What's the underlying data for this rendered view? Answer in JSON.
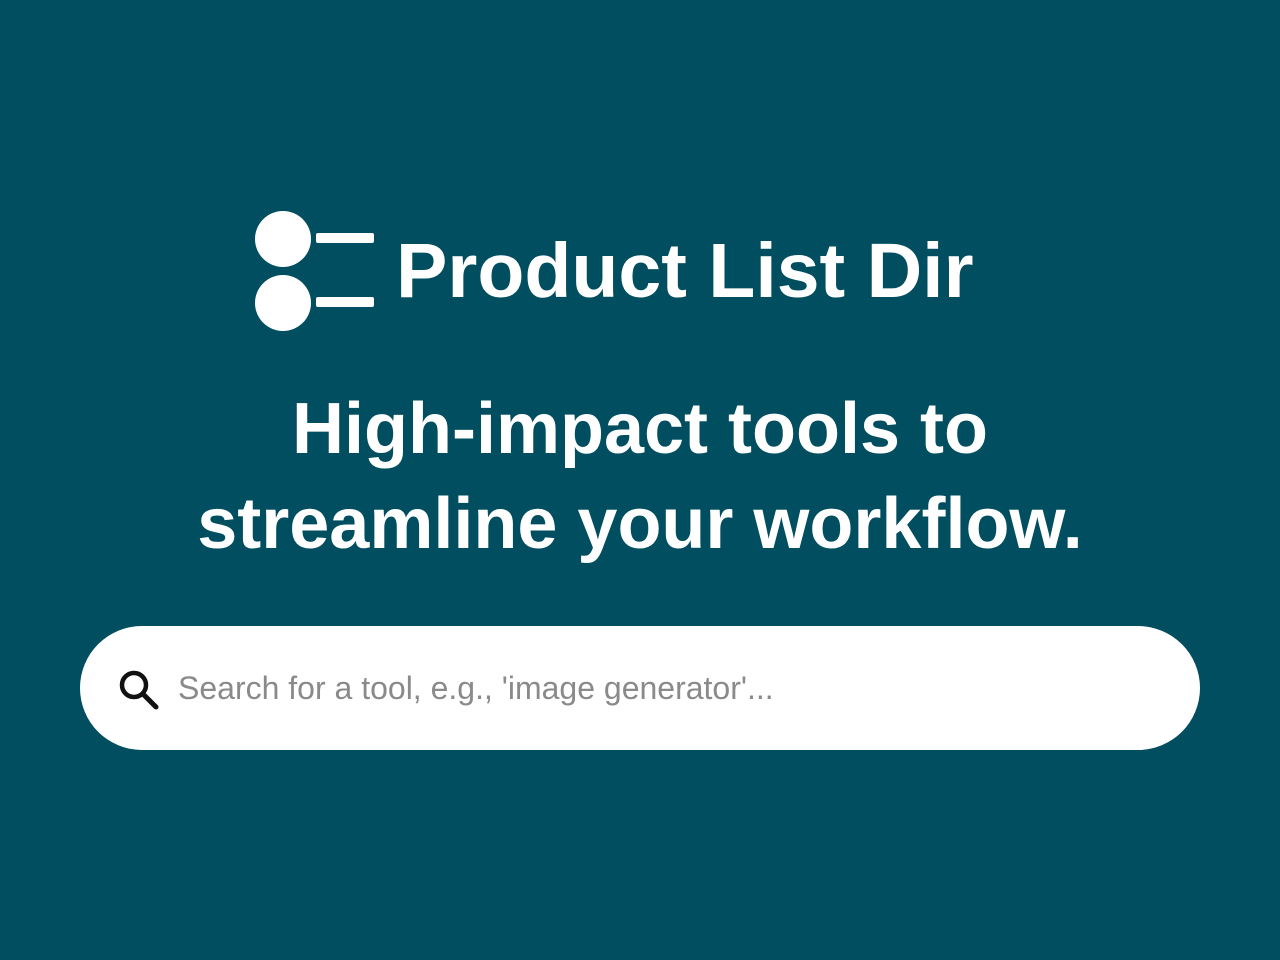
{
  "brand": {
    "name": "Product List Dir",
    "logo_icon": "list-icon"
  },
  "hero": {
    "headline_line1": "High-impact tools to",
    "headline_line2": "streamline your workflow."
  },
  "search": {
    "icon": "search-icon",
    "placeholder": "Search for a tool, e.g., 'image generator'...",
    "value": ""
  },
  "colors": {
    "background": "#004e5f",
    "text": "#ffffff",
    "search_bg": "#ffffff",
    "placeholder": "#8a8a8a"
  }
}
